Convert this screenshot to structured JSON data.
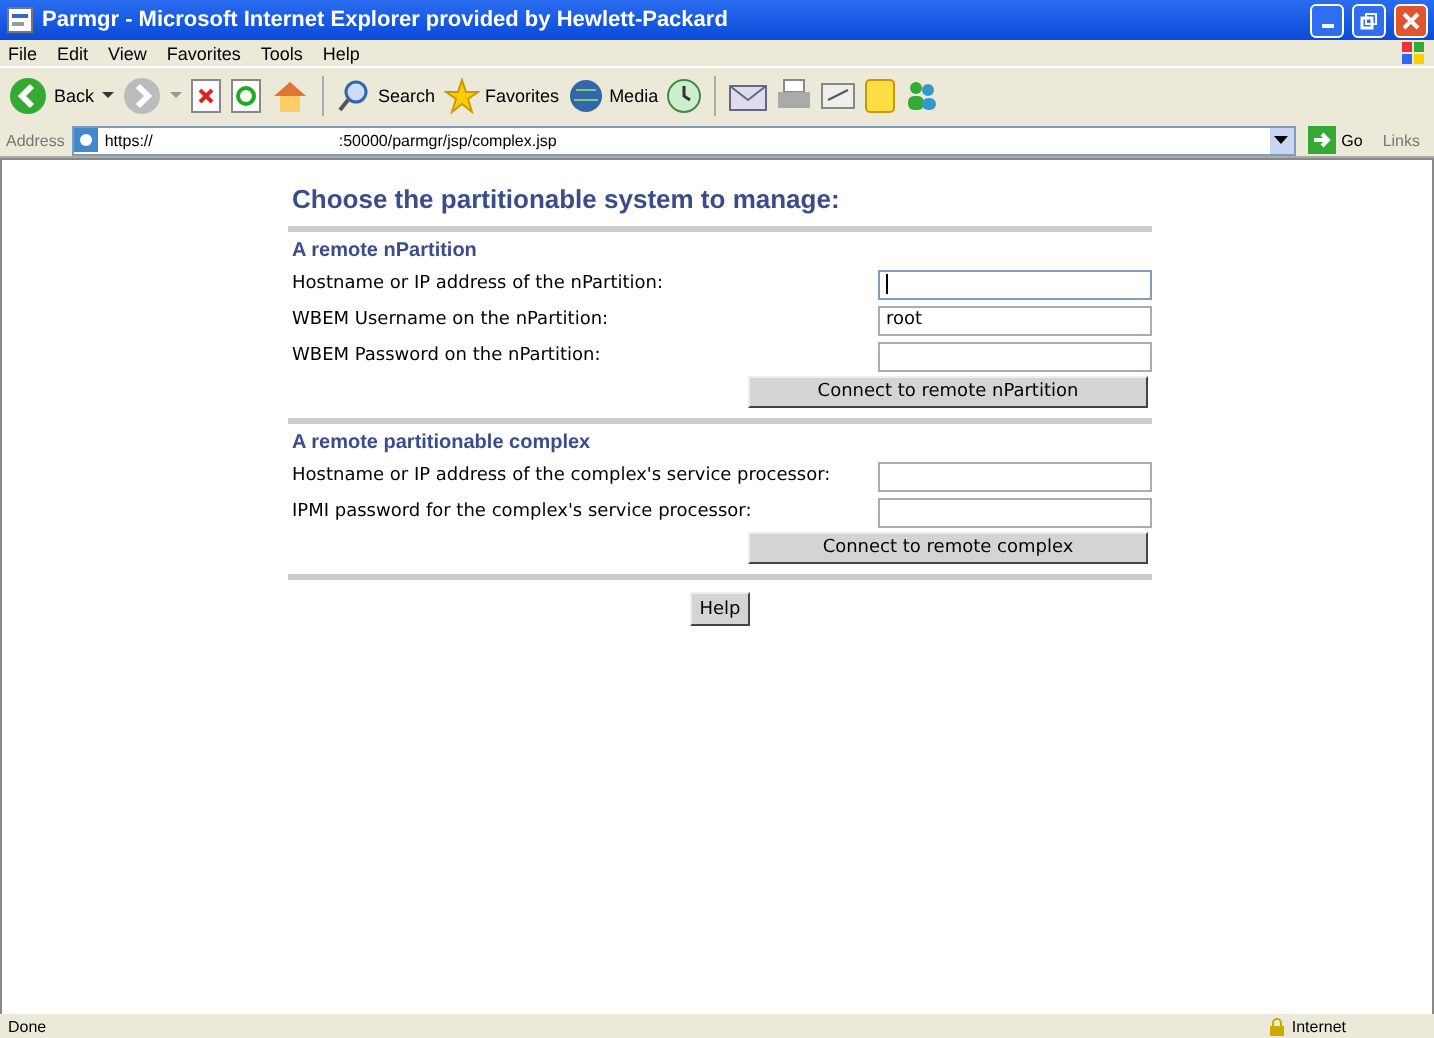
{
  "window": {
    "title": "Parmgr - Microsoft Internet Explorer provided by Hewlett-Packard"
  },
  "menu": [
    "File",
    "Edit",
    "View",
    "Favorites",
    "Tools",
    "Help"
  ],
  "toolbar": {
    "back": "Back",
    "search": "Search",
    "favorites": "Favorites",
    "media": "Media"
  },
  "address_bar": {
    "label": "Address",
    "url_start": "https://",
    "url_end": ":50000/parmgr/jsp/complex.jsp",
    "go": "Go",
    "links": "Links"
  },
  "page": {
    "heading": "Choose the partitionable system to manage:",
    "sections": [
      {
        "title": "A remote nPartition",
        "fields": [
          {
            "label": "Hostname or IP address of the nPartition:",
            "focused": true
          },
          {
            "label": "WBEM Username on the nPartition:",
            "value": "root",
            "focused": false
          },
          {
            "label": "WBEM Password on the nPartition:",
            "focused": false
          }
        ],
        "button": "Connect to remote nPartition"
      },
      {
        "title": "A remote partitionable complex",
        "fields": [
          {
            "label": "Hostname or IP address of the complex's service processor:",
            "focused": false
          },
          {
            "label": "IPMI password for the complex's service processor:",
            "focused": false
          }
        ],
        "button": "Connect to remote complex"
      }
    ],
    "help": "Help"
  },
  "status_bar": {
    "status": "Done",
    "zone": "Internet"
  }
}
